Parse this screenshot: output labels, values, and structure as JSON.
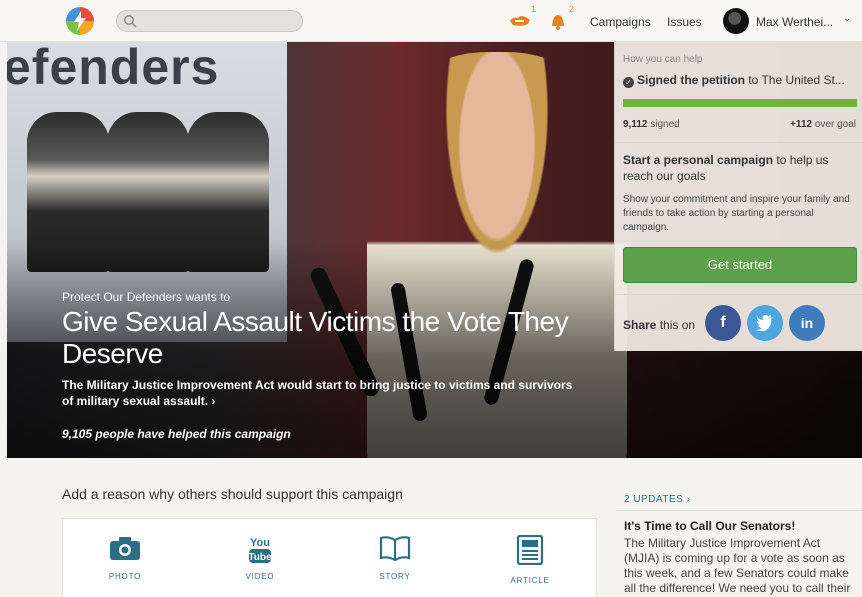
{
  "topbar": {
    "search_placeholder": "",
    "notifications": [
      {
        "icon": "handshake-icon",
        "count": "1"
      },
      {
        "icon": "bell-icon",
        "count": "2"
      }
    ],
    "nav": {
      "campaigns": "Campaigns",
      "issues": "Issues"
    },
    "user_name": "Max Werthei...",
    "chevron": "⌄"
  },
  "hero": {
    "poster_text": "efenders",
    "org_line": "Protect Our Defenders wants to",
    "title": "Give Sexual Assault Victims the Vote They Deserve",
    "description": "The Military Justice Improvement Act would start to bring justice to victims and survivors of military sexual assault. ›",
    "helped": "9,105 people have helped this campaign"
  },
  "panel": {
    "how_help": "How you can help",
    "signed_bold": "Signed the petition",
    "signed_rest": " to The United St...",
    "progress_fraction": 1.0,
    "signed_count": "9,112",
    "signed_word": " signed",
    "over_goal_num": "+112",
    "over_goal_word": " over goal",
    "start_bold": "Start a personal campaign",
    "start_rest": " to help us reach our goals",
    "body": "Show your commitment and inspire your family and friends to take action by starting a personal campaign.",
    "button": "Get started",
    "share_bold": "Share",
    "share_rest": " this on",
    "social": [
      {
        "name": "facebook",
        "glyph": "f",
        "color": "#3b5998"
      },
      {
        "name": "twitter",
        "glyph": "t",
        "color": "#4da7de"
      },
      {
        "name": "linkedin",
        "glyph": "in",
        "color": "#3f7cba"
      }
    ]
  },
  "main": {
    "add_reason": "Add a reason why others should support this campaign",
    "media": [
      {
        "label": "PHOTO",
        "icon": "camera-icon"
      },
      {
        "label": "VIDEO",
        "icon": "youtube-icon"
      },
      {
        "label": "STORY",
        "icon": "book-icon"
      },
      {
        "label": "ARTICLE",
        "icon": "newspaper-icon"
      }
    ]
  },
  "updates": {
    "header": "2 UPDATES ›",
    "title": "It's Time to Call Our Senators!",
    "body": "The Military Justice Improvement Act (MJIA) is coming up for a vote as soon as this week, and a few Senators could make all the difference! We need you to call their"
  },
  "colors": {
    "accent": "#2b6f86",
    "green": "#5da24a",
    "progress": "#6fb43f"
  }
}
